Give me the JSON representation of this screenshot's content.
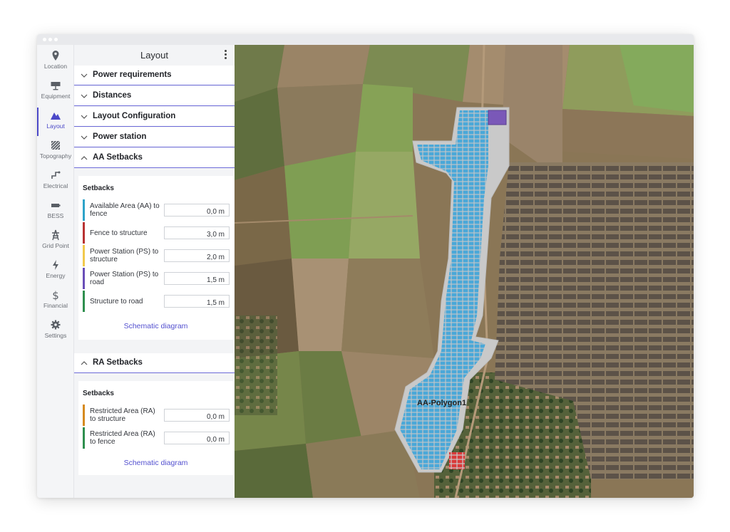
{
  "window": {
    "sidebar": [
      {
        "id": "location",
        "label": "Location",
        "icon": "location-pin-icon"
      },
      {
        "id": "equipment",
        "label": "Equipment",
        "icon": "solar-panel-icon"
      },
      {
        "id": "layout",
        "label": "Layout",
        "icon": "layout-icon",
        "active": true
      },
      {
        "id": "topography",
        "label": "Topography",
        "icon": "topography-icon"
      },
      {
        "id": "electrical",
        "label": "Electrical",
        "icon": "electrical-icon"
      },
      {
        "id": "bess",
        "label": "BESS",
        "icon": "battery-icon"
      },
      {
        "id": "gridpoint",
        "label": "Grid Point",
        "icon": "grid-tower-icon"
      },
      {
        "id": "energy",
        "label": "Energy",
        "icon": "lightning-icon"
      },
      {
        "id": "financial",
        "label": "Financial",
        "icon": "dollar-icon"
      },
      {
        "id": "settings",
        "label": "Settings",
        "icon": "gear-icon"
      }
    ]
  },
  "panel": {
    "title": "Layout",
    "sections": [
      {
        "label": "Power requirements",
        "expanded": false
      },
      {
        "label": "Distances",
        "expanded": false
      },
      {
        "label": "Layout Configuration",
        "expanded": false
      },
      {
        "label": "Power station",
        "expanded": false
      },
      {
        "label": "AA Setbacks",
        "expanded": true
      }
    ],
    "aa_setbacks": {
      "subtitle": "Setbacks",
      "rows": [
        {
          "label": "Available Area (AA) to fence",
          "value": "0,0 m",
          "color": "#2ea3c9"
        },
        {
          "label": "Fence to structure",
          "value": "3,0 m",
          "color": "#b83232"
        },
        {
          "label": "Power Station (PS) to structure",
          "value": "2,0 m",
          "color": "#f2c94c"
        },
        {
          "label": "Power Station (PS) to road",
          "value": "1,5 m",
          "color": "#6a4fb8"
        },
        {
          "label": "Structure to road",
          "value": "1,5 m",
          "color": "#2f8f4e"
        }
      ],
      "link": "Schematic diagram"
    },
    "ra_section": {
      "label": "RA Setbacks",
      "expanded": true
    },
    "ra_setbacks": {
      "subtitle": "Setbacks",
      "rows": [
        {
          "label": "Restricted Area (RA) to structure",
          "value": "0,0 m",
          "color": "#d68a1f"
        },
        {
          "label": "Restricted Area (RA) to fence",
          "value": "0,0 m",
          "color": "#2f8f4e"
        }
      ],
      "link": "Schematic diagram"
    }
  },
  "map": {
    "polygon_label": "AA-Polygon1",
    "colors": {
      "panels": "#4aa8d8",
      "restricted": "#d93a3a",
      "power_station": "#7a58b8",
      "boundary": "#c9c9c9"
    }
  },
  "colors": {
    "accent": "#4b48c8"
  }
}
